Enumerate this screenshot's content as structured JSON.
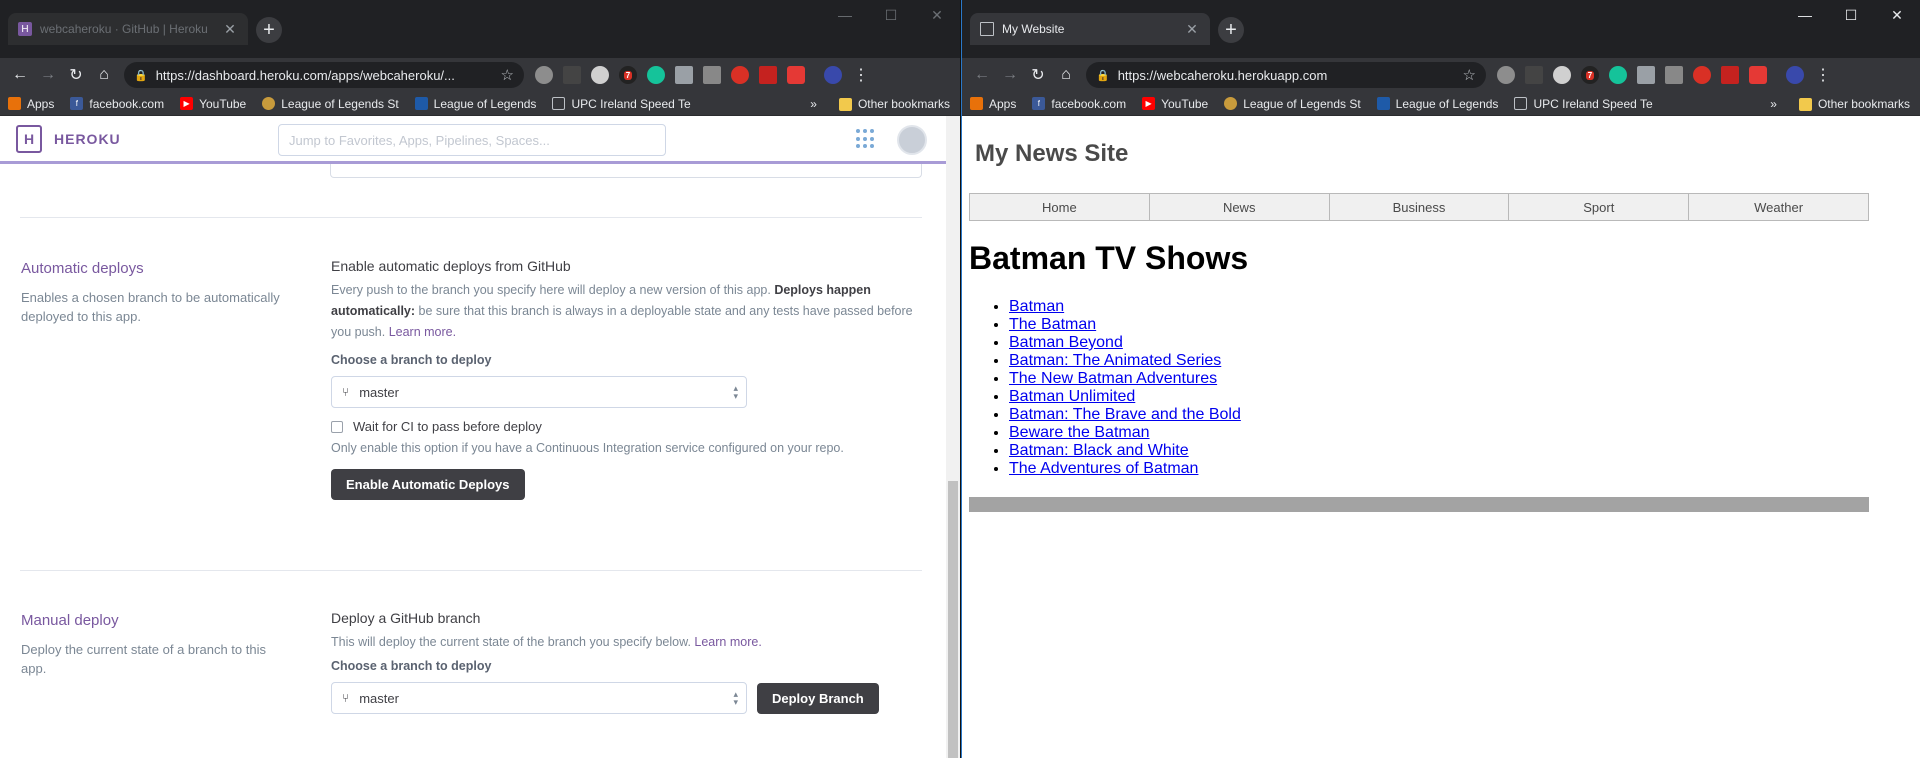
{
  "left_window": {
    "tab_title": "webcaheroku · GitHub | Heroku",
    "url": "https://dashboard.heroku.com/apps/webcaheroku/...",
    "bookmarks": [
      {
        "label": "Apps",
        "color": "#e8710a"
      },
      {
        "label": "facebook.com",
        "color": "#3b5998"
      },
      {
        "label": "YouTube",
        "color": "#ff0000"
      },
      {
        "label": "League of Legends St",
        "color": "#c89b3c"
      },
      {
        "label": "League of Legends",
        "color": "#1e5aa8"
      },
      {
        "label": "UPC Ireland Speed Te",
        "color": "#9aa0a6"
      }
    ],
    "bookmarks_more": "»",
    "other_bookmarks": "Other bookmarks",
    "heroku": {
      "logo_letter": "H",
      "logo_text": "HEROKU",
      "search_placeholder": "Jump to Favorites, Apps, Pipelines, Spaces...",
      "auto": {
        "side_title": "Automatic deploys",
        "side_desc": "Enables a chosen branch to be automatically deployed to this app.",
        "heading": "Enable automatic deploys from GitHub",
        "desc_1": "Every push to the branch you specify here will deploy a new version of this app.",
        "desc_bold": "Deploys happen automatically:",
        "desc_2": "be sure that this branch is always in a deployable state and any tests have passed before you push.",
        "learn_more": "Learn more.",
        "choose_label": "Choose a branch to deploy",
        "branch": "master",
        "wait_ci": "Wait for CI to pass before deploy",
        "ci_hint": "Only enable this option if you have a Continuous Integration service configured on your repo.",
        "button": "Enable Automatic Deploys"
      },
      "manual": {
        "side_title": "Manual deploy",
        "side_desc": "Deploy the current state of a branch to this app.",
        "heading": "Deploy a GitHub branch",
        "desc": "This will deploy the current state of the branch you specify below.",
        "learn_more": "Learn more.",
        "choose_label": "Choose a branch to deploy",
        "branch": "master",
        "button": "Deploy Branch"
      }
    }
  },
  "right_window": {
    "tab_title": "My Website",
    "url": "https://webcaheroku.herokuapp.com",
    "site": {
      "title": "My News Site",
      "nav": [
        "Home",
        "News",
        "Business",
        "Sport",
        "Weather"
      ],
      "heading": "Batman TV Shows",
      "shows": [
        "Batman",
        "The Batman",
        "Batman Beyond",
        "Batman: The Animated Series",
        "The New Batman Adventures",
        "Batman Unlimited",
        "Batman: The Brave and the Bold",
        "Beware the Batman",
        "Batman: Black and White",
        "The Adventures of Batman"
      ]
    }
  },
  "extension_badge": "7",
  "colors": {
    "heroku_purple": "#79589f",
    "chrome_dark": "#35363a",
    "link_blue": "#0000ee"
  }
}
